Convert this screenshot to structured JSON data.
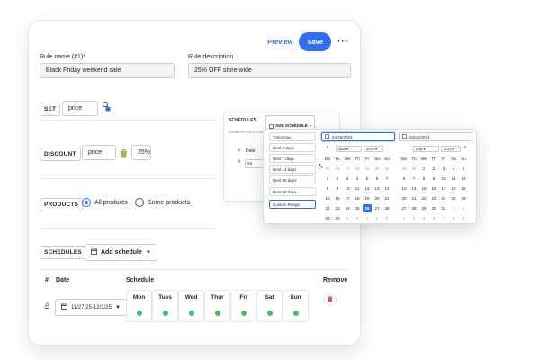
{
  "header": {
    "preview_label": "Preview",
    "save_label": "Save",
    "more_label": "···"
  },
  "rule": {
    "name_label": "Rule name (#1)*",
    "name_value": "Black Friday weekend sale",
    "description_label": "Rule description",
    "description_value": "25% OFF store wide"
  },
  "set": {
    "tag": "SET",
    "value": "price"
  },
  "discount": {
    "tag": "DISCOUNT",
    "type": "price",
    "amount": "25%"
  },
  "products": {
    "tag": "PRODUCTS",
    "options": [
      "All products",
      "Some products"
    ],
    "selected": "All products"
  },
  "schedules": {
    "tag": "SCHEDULES",
    "add_label": "Add schedule",
    "columns": {
      "num": "#",
      "date": "Date",
      "schedule": "Schedule",
      "remove": "Remove"
    },
    "row": {
      "date_range": "11/27/25-12/1/25"
    },
    "days": [
      "Mon",
      "Tues",
      "Wed",
      "Thur",
      "Fri",
      "Sat",
      "Sun"
    ]
  },
  "bg_panel": {
    "tag": "SCHEDULES",
    "add_label": "ADD SCHEDULE",
    "hint": "Activate this rule on a schedule",
    "hash": "#",
    "date": "Date",
    "row_date": "04"
  },
  "popup": {
    "presets": [
      "Tomorrow",
      "Next 2 days",
      "Next 7 days",
      "Next 14 days",
      "Next 30 days",
      "Next 90 days",
      "Custom Range"
    ],
    "active_preset": "Custom Range",
    "start_date": "04/26/2024",
    "end_date": "04/26/2024",
    "left": {
      "month": "April",
      "year": "2024",
      "weekdays": [
        "Mo",
        "Tu",
        "We",
        "Th",
        "Fr",
        "Sa",
        "Su"
      ],
      "weeks": [
        [
          "25",
          "26",
          "27",
          "28",
          "29",
          "30",
          "31"
        ],
        [
          "1",
          "2",
          "3",
          "4",
          "5",
          "6",
          "7"
        ],
        [
          "8",
          "9",
          "10",
          "11",
          "12",
          "13",
          "14"
        ],
        [
          "15",
          "16",
          "17",
          "18",
          "19",
          "20",
          "21"
        ],
        [
          "22",
          "23",
          "24",
          "25",
          "26",
          "27",
          "28"
        ],
        [
          "29",
          "30",
          "1",
          "2",
          "3",
          "4",
          "5"
        ]
      ],
      "selected_day": "26"
    },
    "right": {
      "month": "May",
      "year": "2024",
      "weekdays": [
        "Mo",
        "Tu",
        "We",
        "Th",
        "Fr",
        "Sa",
        "Su"
      ],
      "weeks": [
        [
          "29",
          "30",
          "1",
          "2",
          "3",
          "4",
          "5"
        ],
        [
          "6",
          "7",
          "8",
          "9",
          "10",
          "11",
          "12"
        ],
        [
          "13",
          "14",
          "15",
          "16",
          "17",
          "18",
          "19"
        ],
        [
          "20",
          "21",
          "22",
          "23",
          "24",
          "25",
          "26"
        ],
        [
          "27",
          "28",
          "29",
          "30",
          "31",
          "1",
          "2"
        ],
        [
          "3",
          "4",
          "5",
          "6",
          "7",
          "8",
          "9"
        ]
      ]
    }
  },
  "colors": {
    "accent": "#2f6fed",
    "active_dot": "#3cc35a",
    "remove": "#e05252"
  }
}
